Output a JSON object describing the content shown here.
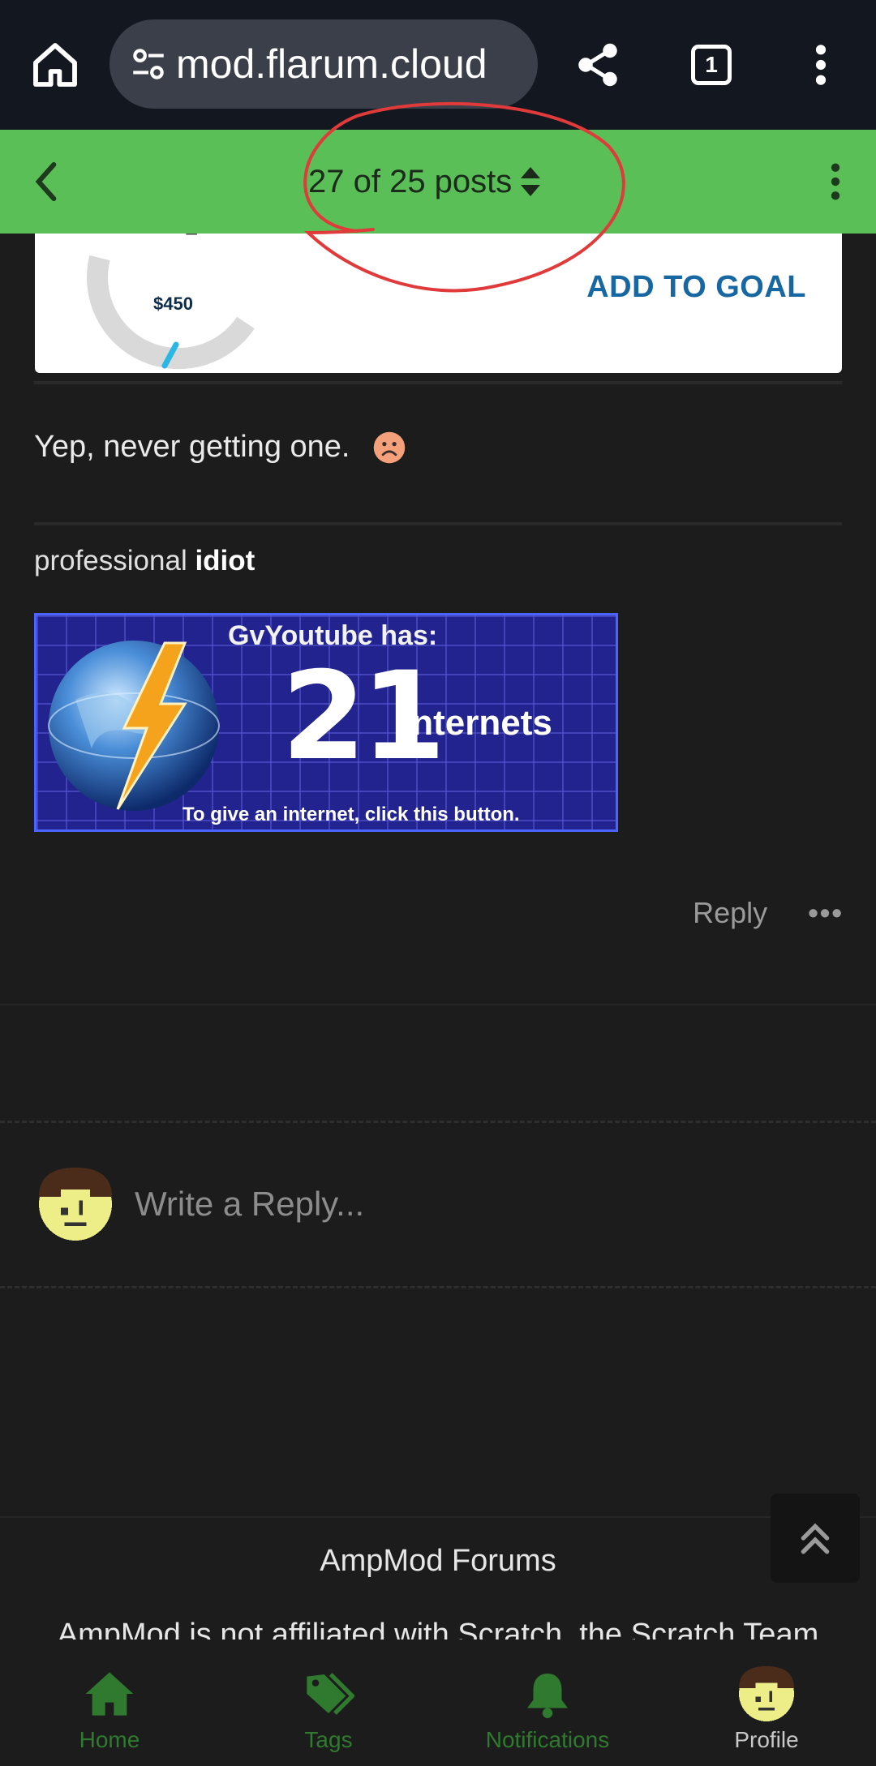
{
  "browser": {
    "url": "mod.flarum.cloud",
    "url_prefix_faded": "›",
    "tab_count": "1"
  },
  "forum_header": {
    "scrubber_text": "27 of 25 posts"
  },
  "embed": {
    "gauge_amount": "$450",
    "action_label": "ADD TO GOAL"
  },
  "post": {
    "text": "Yep, never getting one.",
    "signature_prefix": "professional ",
    "signature_bold": "idiot",
    "badge": {
      "title": "GvYoutube has:",
      "count": "21",
      "unit": "Internets",
      "footnote": "To give an internet, click this button."
    },
    "reply_label": "Reply",
    "more_label": "•••"
  },
  "composer": {
    "placeholder": "Write a Reply..."
  },
  "footer": {
    "title": "AmpMod Forums",
    "description": "AmpMod is not affiliated with Scratch, the Scratch Team"
  },
  "bottom_nav": {
    "items": [
      {
        "label": "Home",
        "icon": "home-icon"
      },
      {
        "label": "Tags",
        "icon": "tags-icon"
      },
      {
        "label": "Notifications",
        "icon": "bell-icon"
      },
      {
        "label": "Profile",
        "icon": "avatar"
      }
    ],
    "active_index": 3
  },
  "colors": {
    "header_green": "#5bbf57",
    "annotation_red": "#e03a3a",
    "background": "#1c1c1c",
    "nav_inactive": "#2f7a2f"
  }
}
